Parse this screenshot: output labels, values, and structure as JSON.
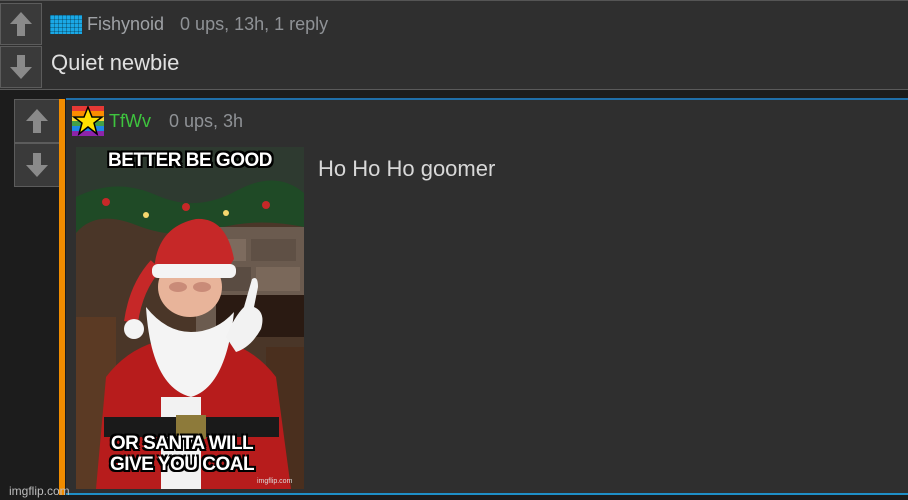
{
  "comments": [
    {
      "username": "Fishynoid",
      "meta": "0 ups, 13h, 1 reply",
      "text": "Quiet newbie"
    },
    {
      "username": "TfWv",
      "meta": "0 ups, 3h",
      "text": "Ho Ho Ho goomer",
      "image": {
        "top_caption": "BETTER BE GOOD",
        "bottom_caption_line1": "OR SANTA WILL",
        "bottom_caption_line2": "GIVE YOU COAL",
        "watermark": "imgflip.com"
      }
    }
  ],
  "footer_watermark": "imgflip.com",
  "colors": {
    "username_green": "#3ec43e",
    "accent_orange": "#f08c00",
    "border_blue": "#1f8fc7"
  },
  "icons": {
    "upvote": "up-arrow-icon",
    "downvote": "down-arrow-icon"
  }
}
